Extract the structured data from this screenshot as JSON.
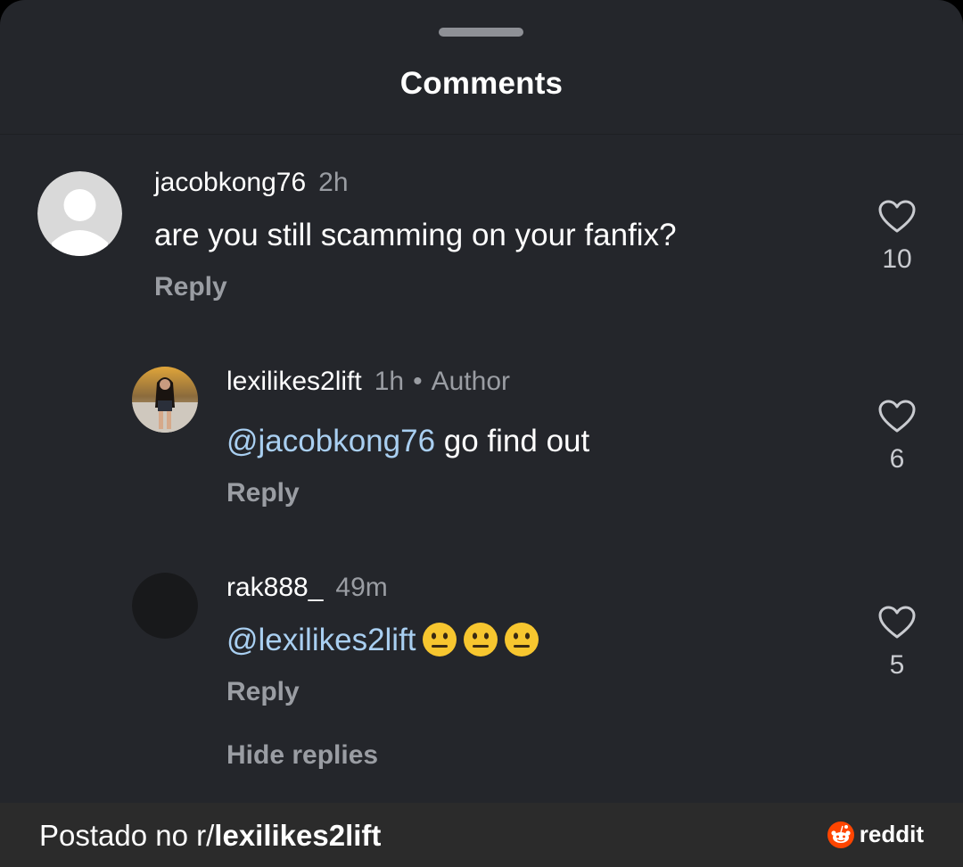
{
  "sheet": {
    "title": "Comments"
  },
  "comments": [
    {
      "username": "jacobkong76",
      "time": "2h",
      "text": "are you still scamming on your fanfix?",
      "reply_label": "Reply",
      "likes": "10",
      "avatar": "default-avatar-icon"
    },
    {
      "username": "lexilikes2lift",
      "time": "1h",
      "author_badge": "Author",
      "mention": "@jacobkong76",
      "text": " go find out",
      "reply_label": "Reply",
      "likes": "6",
      "avatar": "profile-photo"
    },
    {
      "username": "rak888_",
      "time": "49m",
      "mention": "@lexilikes2lift",
      "emojis": [
        "neutral-face-emoji",
        "neutral-face-emoji",
        "neutral-face-emoji"
      ],
      "reply_label": "Reply",
      "likes": "5",
      "avatar": "dark-avatar"
    }
  ],
  "hide_replies_label": "Hide replies",
  "footer": {
    "caption_prefix": "Postado no r/",
    "caption_subreddit": "lexilikes2lift",
    "logo_text": "reddit"
  },
  "colors": {
    "background": "#24262b",
    "mention": "#a9cff1",
    "muted": "#9a9da3",
    "footer": "#2b2b2b"
  }
}
